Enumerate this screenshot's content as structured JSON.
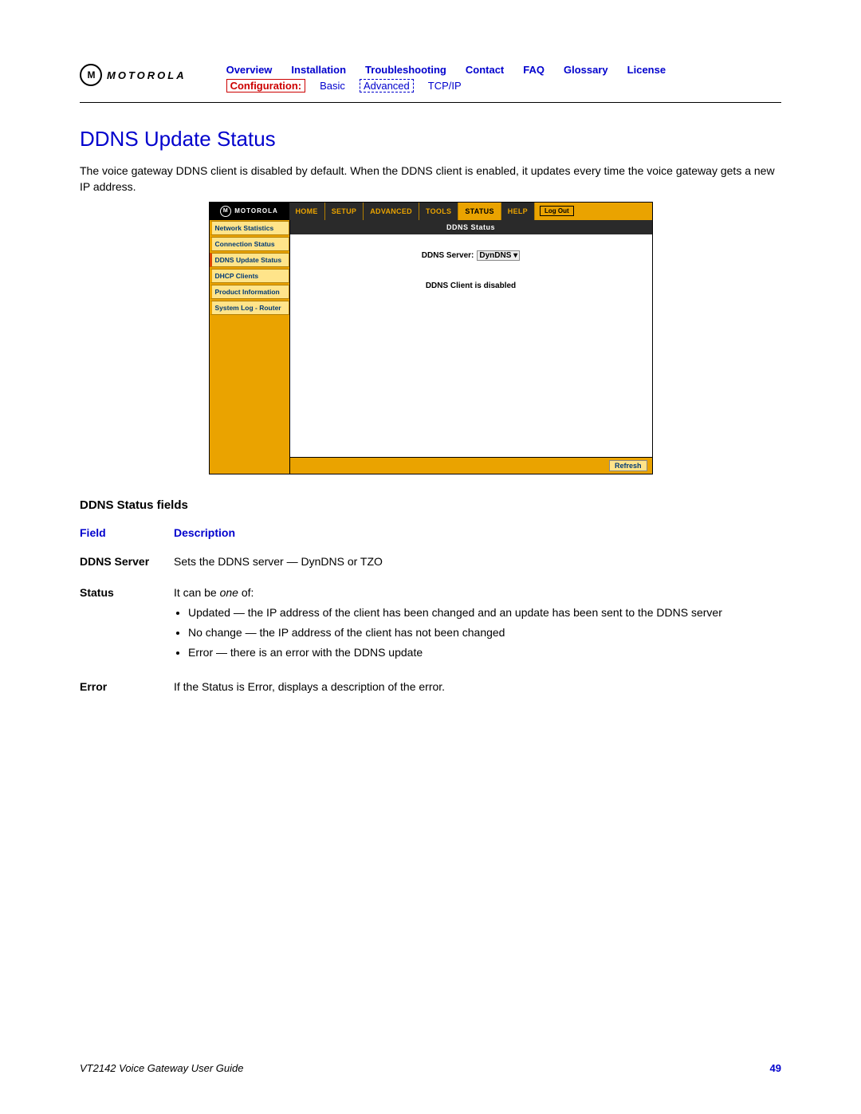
{
  "logo_text": "MOTOROLA",
  "nav": {
    "top": [
      "Overview",
      "Installation",
      "Troubleshooting",
      "Contact",
      "FAQ",
      "Glossary",
      "License"
    ],
    "config_label": "Configuration:",
    "sub": [
      "Basic",
      "Advanced",
      "TCP/IP"
    ]
  },
  "title": "DDNS Update Status",
  "intro": "The voice gateway DDNS client is disabled by default. When the DDNS client is enabled, it updates every time the voice gateway gets a new IP address.",
  "router": {
    "logo": "MOTOROLA",
    "tabs": [
      "HOME",
      "SETUP",
      "ADVANCED",
      "TOOLS",
      "STATUS",
      "HELP"
    ],
    "logout": "Log Out",
    "side_items": [
      "Network Statistics",
      "Connection Status",
      "DDNS Update Status",
      "DHCP Clients",
      "Product Information",
      "System Log - Router"
    ],
    "main_title": "DDNS Status",
    "server_label": "DDNS Server:",
    "server_value": "DynDNS",
    "disabled_msg": "DDNS Client is disabled",
    "refresh": "Refresh"
  },
  "fields_title": "DDNS Status fields",
  "table": {
    "head_field": "Field",
    "head_desc": "Description",
    "rows": [
      {
        "field": "DDNS Server",
        "desc": "Sets the DDNS server — DynDNS or TZO"
      },
      {
        "field": "Status",
        "desc_intro": "It can be one of:",
        "bullets": [
          "Updated — the IP address of the client has been changed and an update has been sent to the DDNS server",
          "No change — the IP address of the client has not been changed",
          "Error — there is an error with the DDNS update"
        ]
      },
      {
        "field": "Error",
        "desc": "If the Status is Error, displays a description of the error."
      }
    ]
  },
  "footer": {
    "guide": "VT2142 Voice Gateway User Guide",
    "page": "49"
  }
}
